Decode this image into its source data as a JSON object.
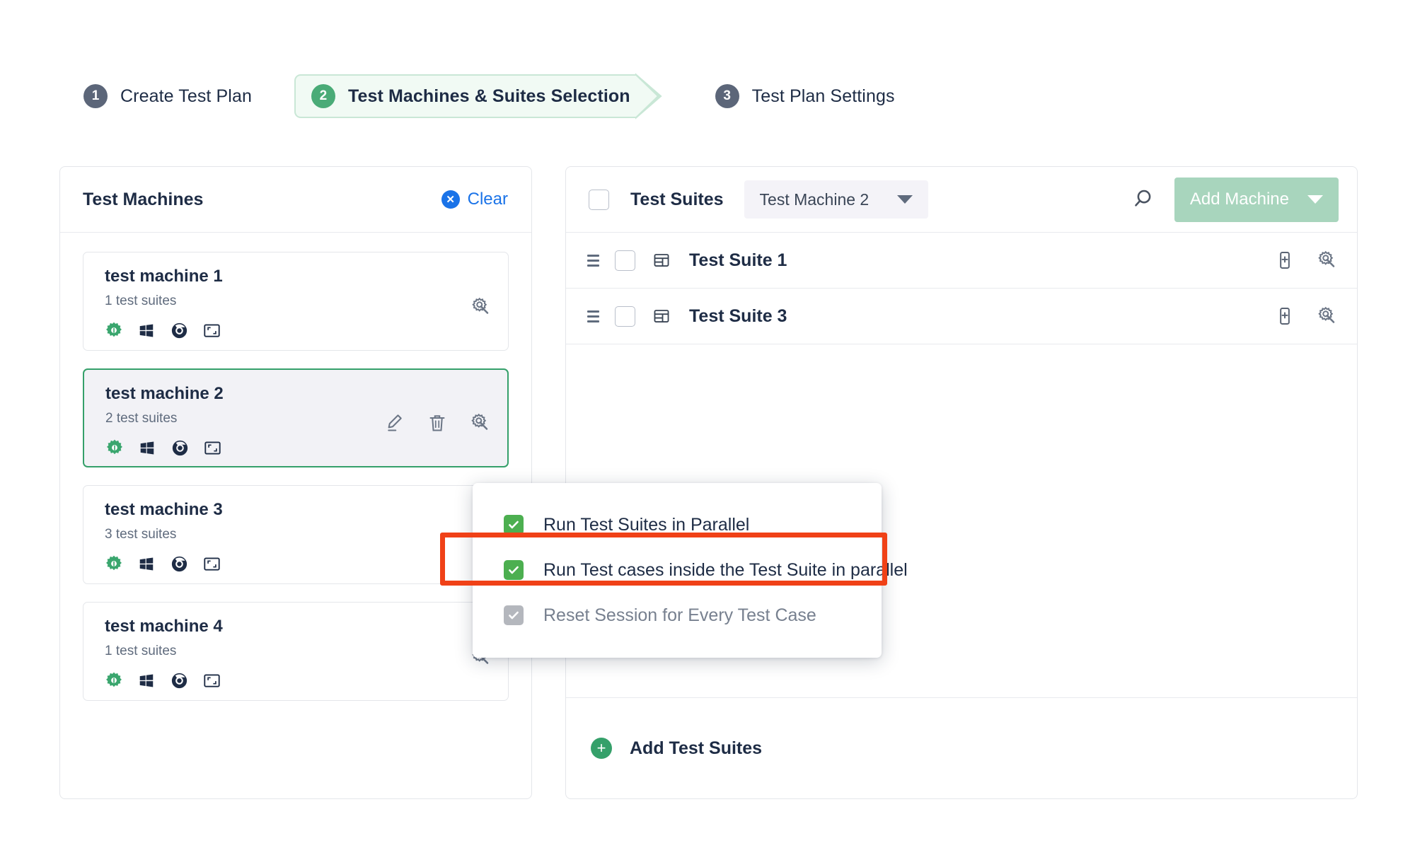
{
  "stepper": {
    "steps": [
      {
        "number": "1",
        "label": "Create Test Plan",
        "active": false
      },
      {
        "number": "2",
        "label": "Test Machines & Suites Selection",
        "active": true
      },
      {
        "number": "3",
        "label": "Test Plan Settings",
        "active": false
      }
    ]
  },
  "left_panel": {
    "title": "Test Machines",
    "clear_label": "Clear",
    "clear_icon": "close-circle-icon",
    "machines": [
      {
        "name": "test machine 1",
        "suites_text": "1 test suites",
        "platform_icons": [
          "green-gear-icon",
          "windows-icon",
          "chrome-icon",
          "screen-resolution-icon"
        ],
        "actions": [
          "gear-slash-icon"
        ],
        "selected": false
      },
      {
        "name": "test machine 2",
        "suites_text": "2 test suites",
        "platform_icons": [
          "green-gear-icon",
          "windows-icon",
          "chrome-icon",
          "screen-resolution-icon"
        ],
        "actions": [
          "pencil-icon",
          "trash-icon",
          "gear-slash-icon"
        ],
        "selected": true
      },
      {
        "name": "test machine 3",
        "suites_text": "3 test suites",
        "platform_icons": [
          "green-gear-icon",
          "windows-icon",
          "chrome-icon",
          "screen-resolution-icon"
        ],
        "actions": [],
        "selected": false
      },
      {
        "name": "test machine 4",
        "suites_text": "1 test suites",
        "platform_icons": [
          "green-gear-icon",
          "windows-icon",
          "chrome-icon",
          "screen-resolution-icon"
        ],
        "actions": [
          "gear-slash-icon"
        ],
        "selected": false
      }
    ]
  },
  "right_panel": {
    "title": "Test Suites",
    "machine_filter": {
      "value": "Test Machine 2",
      "icon": "chevron-down-icon"
    },
    "search_icon": "search-icon",
    "add_machine": {
      "label": "Add Machine",
      "icon": "chevron-down-icon",
      "disabled": true
    },
    "suites": [
      {
        "name": "Test Suite 1",
        "checked": false
      },
      {
        "name": "Test Suite 3",
        "checked": false
      }
    ],
    "footer": {
      "label": "Add Test Suites",
      "icon": "plus-circle-icon"
    }
  },
  "context_menu": {
    "items": [
      {
        "label": "Run Test Suites in Parallel",
        "checked": true,
        "disabled": false
      },
      {
        "label": "Run Test cases inside the Test Suite in parallel",
        "checked": true,
        "disabled": false
      },
      {
        "label": "Reset Session for Every Test Case",
        "checked": true,
        "disabled": true
      }
    ]
  },
  "annotation": {
    "target": "Run Test cases inside the Test Suite in parallel",
    "color": "#f04117"
  },
  "colors": {
    "accent_green": "#4aab77",
    "selected_border": "#35a06a",
    "link_blue": "#1a73e8",
    "text_dark": "#1e2c45",
    "text_muted": "#5f6b7d",
    "annotation_red": "#f04117",
    "add_machine_bg": "#a8d5bd",
    "check_green": "#4caf50"
  }
}
